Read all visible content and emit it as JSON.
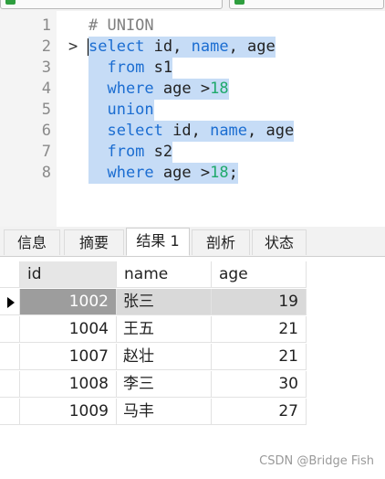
{
  "editor": {
    "lines": [
      {
        "num": "1",
        "mark": "",
        "tokens": [
          {
            "t": "# UNION",
            "c": "cm"
          }
        ],
        "hl": false
      },
      {
        "num": "2",
        "mark": ">",
        "tokens": [
          {
            "t": "select",
            "c": "kw"
          },
          {
            "t": " id, ",
            "c": "tx"
          },
          {
            "t": "name",
            "c": "kw"
          },
          {
            "t": ", age",
            "c": "tx"
          }
        ],
        "hl": true
      },
      {
        "num": "3",
        "mark": "",
        "tokens": [
          {
            "t": "  from",
            "c": "kw"
          },
          {
            "t": " s1",
            "c": "tx"
          }
        ],
        "hl": true
      },
      {
        "num": "4",
        "mark": "",
        "tokens": [
          {
            "t": "  where",
            "c": "kw"
          },
          {
            "t": " age >",
            "c": "tx"
          },
          {
            "t": "18",
            "c": "num"
          }
        ],
        "hl": true
      },
      {
        "num": "5",
        "mark": "",
        "tokens": [
          {
            "t": "  union",
            "c": "kw"
          }
        ],
        "hl": true
      },
      {
        "num": "6",
        "mark": "",
        "tokens": [
          {
            "t": "  select",
            "c": "kw"
          },
          {
            "t": " id, ",
            "c": "tx"
          },
          {
            "t": "name",
            "c": "kw"
          },
          {
            "t": ", age",
            "c": "tx"
          }
        ],
        "hl": true
      },
      {
        "num": "7",
        "mark": "",
        "tokens": [
          {
            "t": "  from",
            "c": "kw"
          },
          {
            "t": " s2",
            "c": "tx"
          }
        ],
        "hl": true
      },
      {
        "num": "8",
        "mark": "",
        "tokens": [
          {
            "t": "  where",
            "c": "kw"
          },
          {
            "t": " age >",
            "c": "tx"
          },
          {
            "t": "18",
            "c": "num"
          },
          {
            "t": ";",
            "c": "tx"
          }
        ],
        "hl": true
      }
    ]
  },
  "tabs": [
    {
      "label": "信息",
      "active": false
    },
    {
      "label": "摘要",
      "active": false
    },
    {
      "label": "结果 1",
      "active": true
    },
    {
      "label": "剖析",
      "active": false
    },
    {
      "label": "状态",
      "active": false
    }
  ],
  "results": {
    "columns": [
      "id",
      "name",
      "age"
    ],
    "rows": [
      {
        "id": "1002",
        "name": "张三",
        "age": "19",
        "selected": true
      },
      {
        "id": "1004",
        "name": "王五",
        "age": "21",
        "selected": false
      },
      {
        "id": "1007",
        "name": "赵壮",
        "age": "21",
        "selected": false
      },
      {
        "id": "1008",
        "name": "李三",
        "age": "30",
        "selected": false
      },
      {
        "id": "1009",
        "name": "马丰",
        "age": "27",
        "selected": false
      }
    ]
  },
  "colors": {
    "keyword": "#1b6dd1",
    "number": "#1fa96b",
    "selection": "#c6dcf6"
  },
  "watermark": "CSDN @Bridge Fish"
}
